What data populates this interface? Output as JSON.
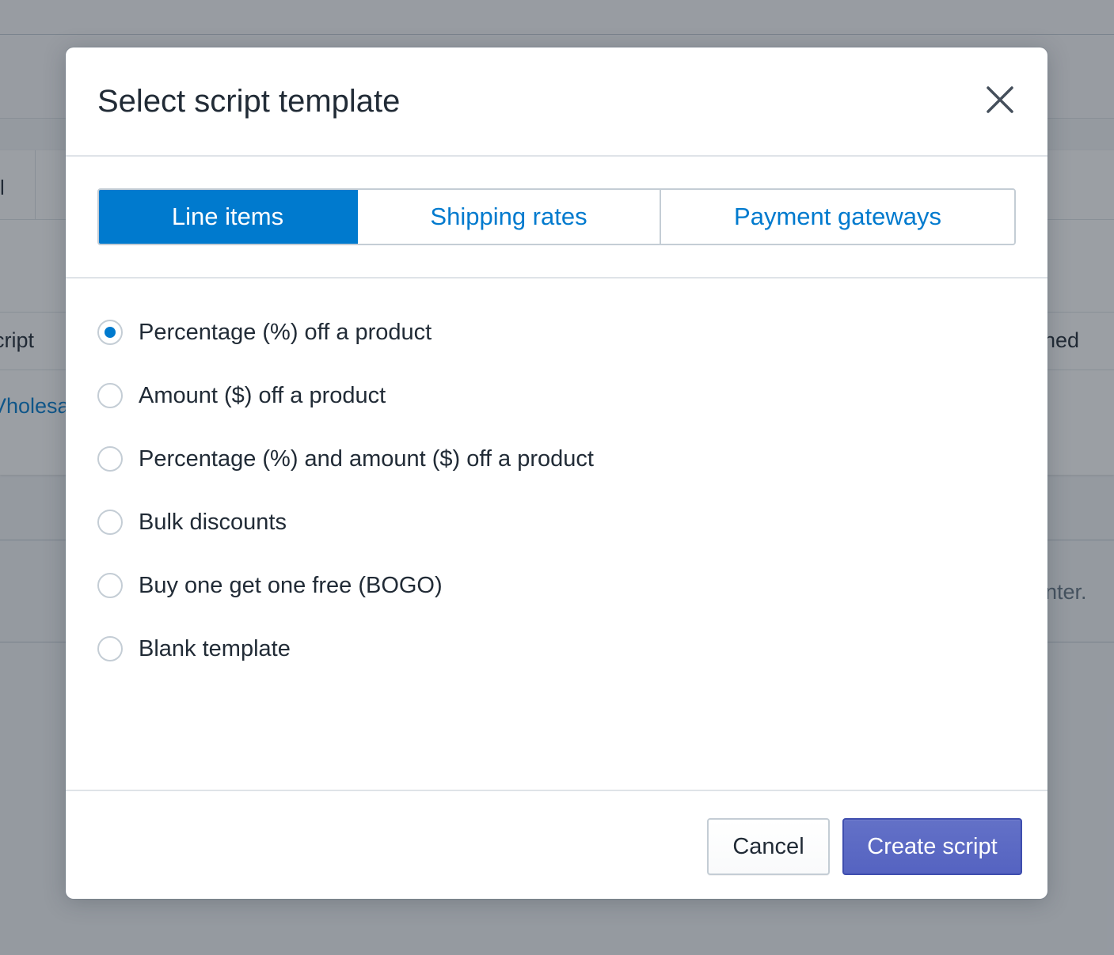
{
  "background": {
    "tab_mark": "l",
    "column_script": "cript",
    "column_right": "ned",
    "row_link": "Vholesa",
    "footer_text": "nter."
  },
  "modal": {
    "title": "Select script template",
    "close_icon": "close-icon",
    "tabs": [
      {
        "label": "Line items",
        "active": true
      },
      {
        "label": "Shipping rates",
        "active": false
      },
      {
        "label": "Payment gateways",
        "active": false
      }
    ],
    "options": [
      {
        "label": "Percentage (%) off a product",
        "selected": true
      },
      {
        "label": "Amount ($) off a product",
        "selected": false
      },
      {
        "label": "Percentage (%) and amount ($) off a product",
        "selected": false
      },
      {
        "label": "Bulk discounts",
        "selected": false
      },
      {
        "label": "Buy one get one free (BOGO)",
        "selected": false
      },
      {
        "label": "Blank template",
        "selected": false
      }
    ],
    "footer": {
      "cancel_label": "Cancel",
      "primary_label": "Create script"
    }
  },
  "colors": {
    "accent": "#007ace",
    "primary_button": "#5c6ac4",
    "text": "#212b36",
    "border": "#c4cdd5"
  }
}
